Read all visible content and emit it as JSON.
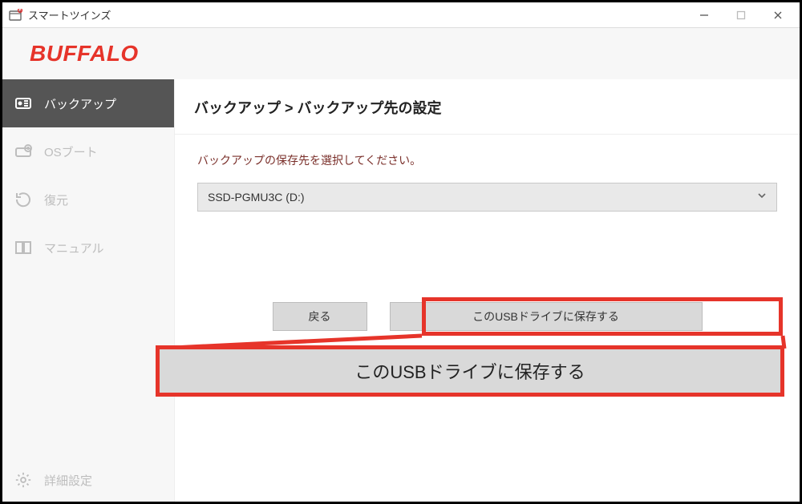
{
  "window": {
    "title": "スマートツインズ"
  },
  "brand": "BUFFALO",
  "sidebar": {
    "items": [
      {
        "label": "バックアップ"
      },
      {
        "label": "OSブート"
      },
      {
        "label": "復元"
      },
      {
        "label": "マニュアル"
      }
    ],
    "settings_label": "詳細設定"
  },
  "main": {
    "breadcrumb": "バックアップ > バックアップ先の設定",
    "instruction": "バックアップの保存先を選択してください。",
    "select_value": "SSD-PGMU3C (D:)",
    "back_label": "戻る",
    "save_label": "このUSBドライブに保存する",
    "highlight_large_label": "このUSBドライブに保存する"
  }
}
